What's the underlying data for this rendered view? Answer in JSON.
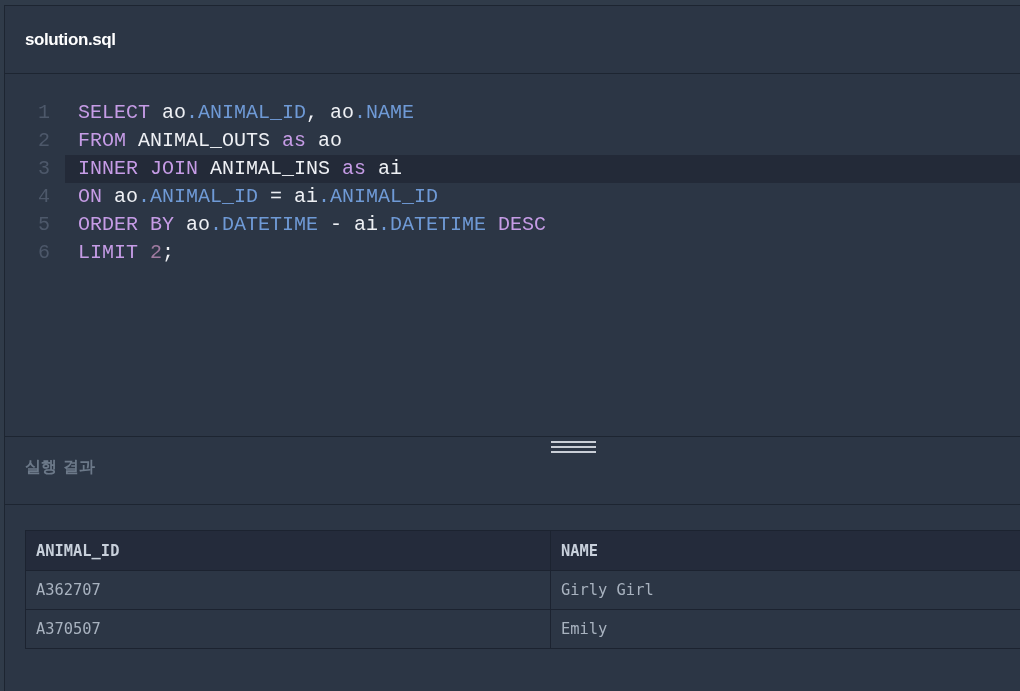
{
  "file": {
    "name": "solution.sql"
  },
  "editor": {
    "lines": [
      {
        "number": "1",
        "active": false,
        "tokens": [
          {
            "kind": "keyword",
            "text": "SELECT"
          },
          {
            "kind": "plain",
            "text": " ao"
          },
          {
            "kind": "property",
            "text": ".ANIMAL_ID"
          },
          {
            "kind": "plain",
            "text": ", ao"
          },
          {
            "kind": "property",
            "text": ".NAME"
          }
        ]
      },
      {
        "number": "2",
        "active": false,
        "tokens": [
          {
            "kind": "keyword",
            "text": "FROM"
          },
          {
            "kind": "plain",
            "text": " ANIMAL_OUTS "
          },
          {
            "kind": "keyword",
            "text": "as"
          },
          {
            "kind": "plain",
            "text": " ao"
          }
        ]
      },
      {
        "number": "3",
        "active": true,
        "tokens": [
          {
            "kind": "keyword",
            "text": "INNER JOIN"
          },
          {
            "kind": "plain",
            "text": " ANIMAL_INS "
          },
          {
            "kind": "keyword",
            "text": "as"
          },
          {
            "kind": "plain",
            "text": " ai"
          }
        ]
      },
      {
        "number": "4",
        "active": false,
        "tokens": [
          {
            "kind": "keyword",
            "text": "ON"
          },
          {
            "kind": "plain",
            "text": " ao"
          },
          {
            "kind": "property",
            "text": ".ANIMAL_ID"
          },
          {
            "kind": "plain",
            "text": " = ai"
          },
          {
            "kind": "property",
            "text": ".ANIMAL_ID"
          }
        ]
      },
      {
        "number": "5",
        "active": false,
        "tokens": [
          {
            "kind": "keyword",
            "text": "ORDER BY"
          },
          {
            "kind": "plain",
            "text": " ao"
          },
          {
            "kind": "property",
            "text": ".DATETIME"
          },
          {
            "kind": "plain",
            "text": " - ai"
          },
          {
            "kind": "property",
            "text": ".DATETIME"
          },
          {
            "kind": "keyword",
            "text": " DESC"
          }
        ]
      },
      {
        "number": "6",
        "active": false,
        "tokens": [
          {
            "kind": "keyword",
            "text": "LIMIT"
          },
          {
            "kind": "number",
            "text": " 2"
          },
          {
            "kind": "plain",
            "text": ";"
          }
        ]
      }
    ]
  },
  "result": {
    "title": "실행 결과",
    "table": {
      "columns": [
        "ANIMAL_ID",
        "NAME"
      ],
      "rows": [
        [
          "A362707",
          "Girly Girl"
        ],
        [
          "A370507",
          "Emily"
        ]
      ]
    }
  }
}
